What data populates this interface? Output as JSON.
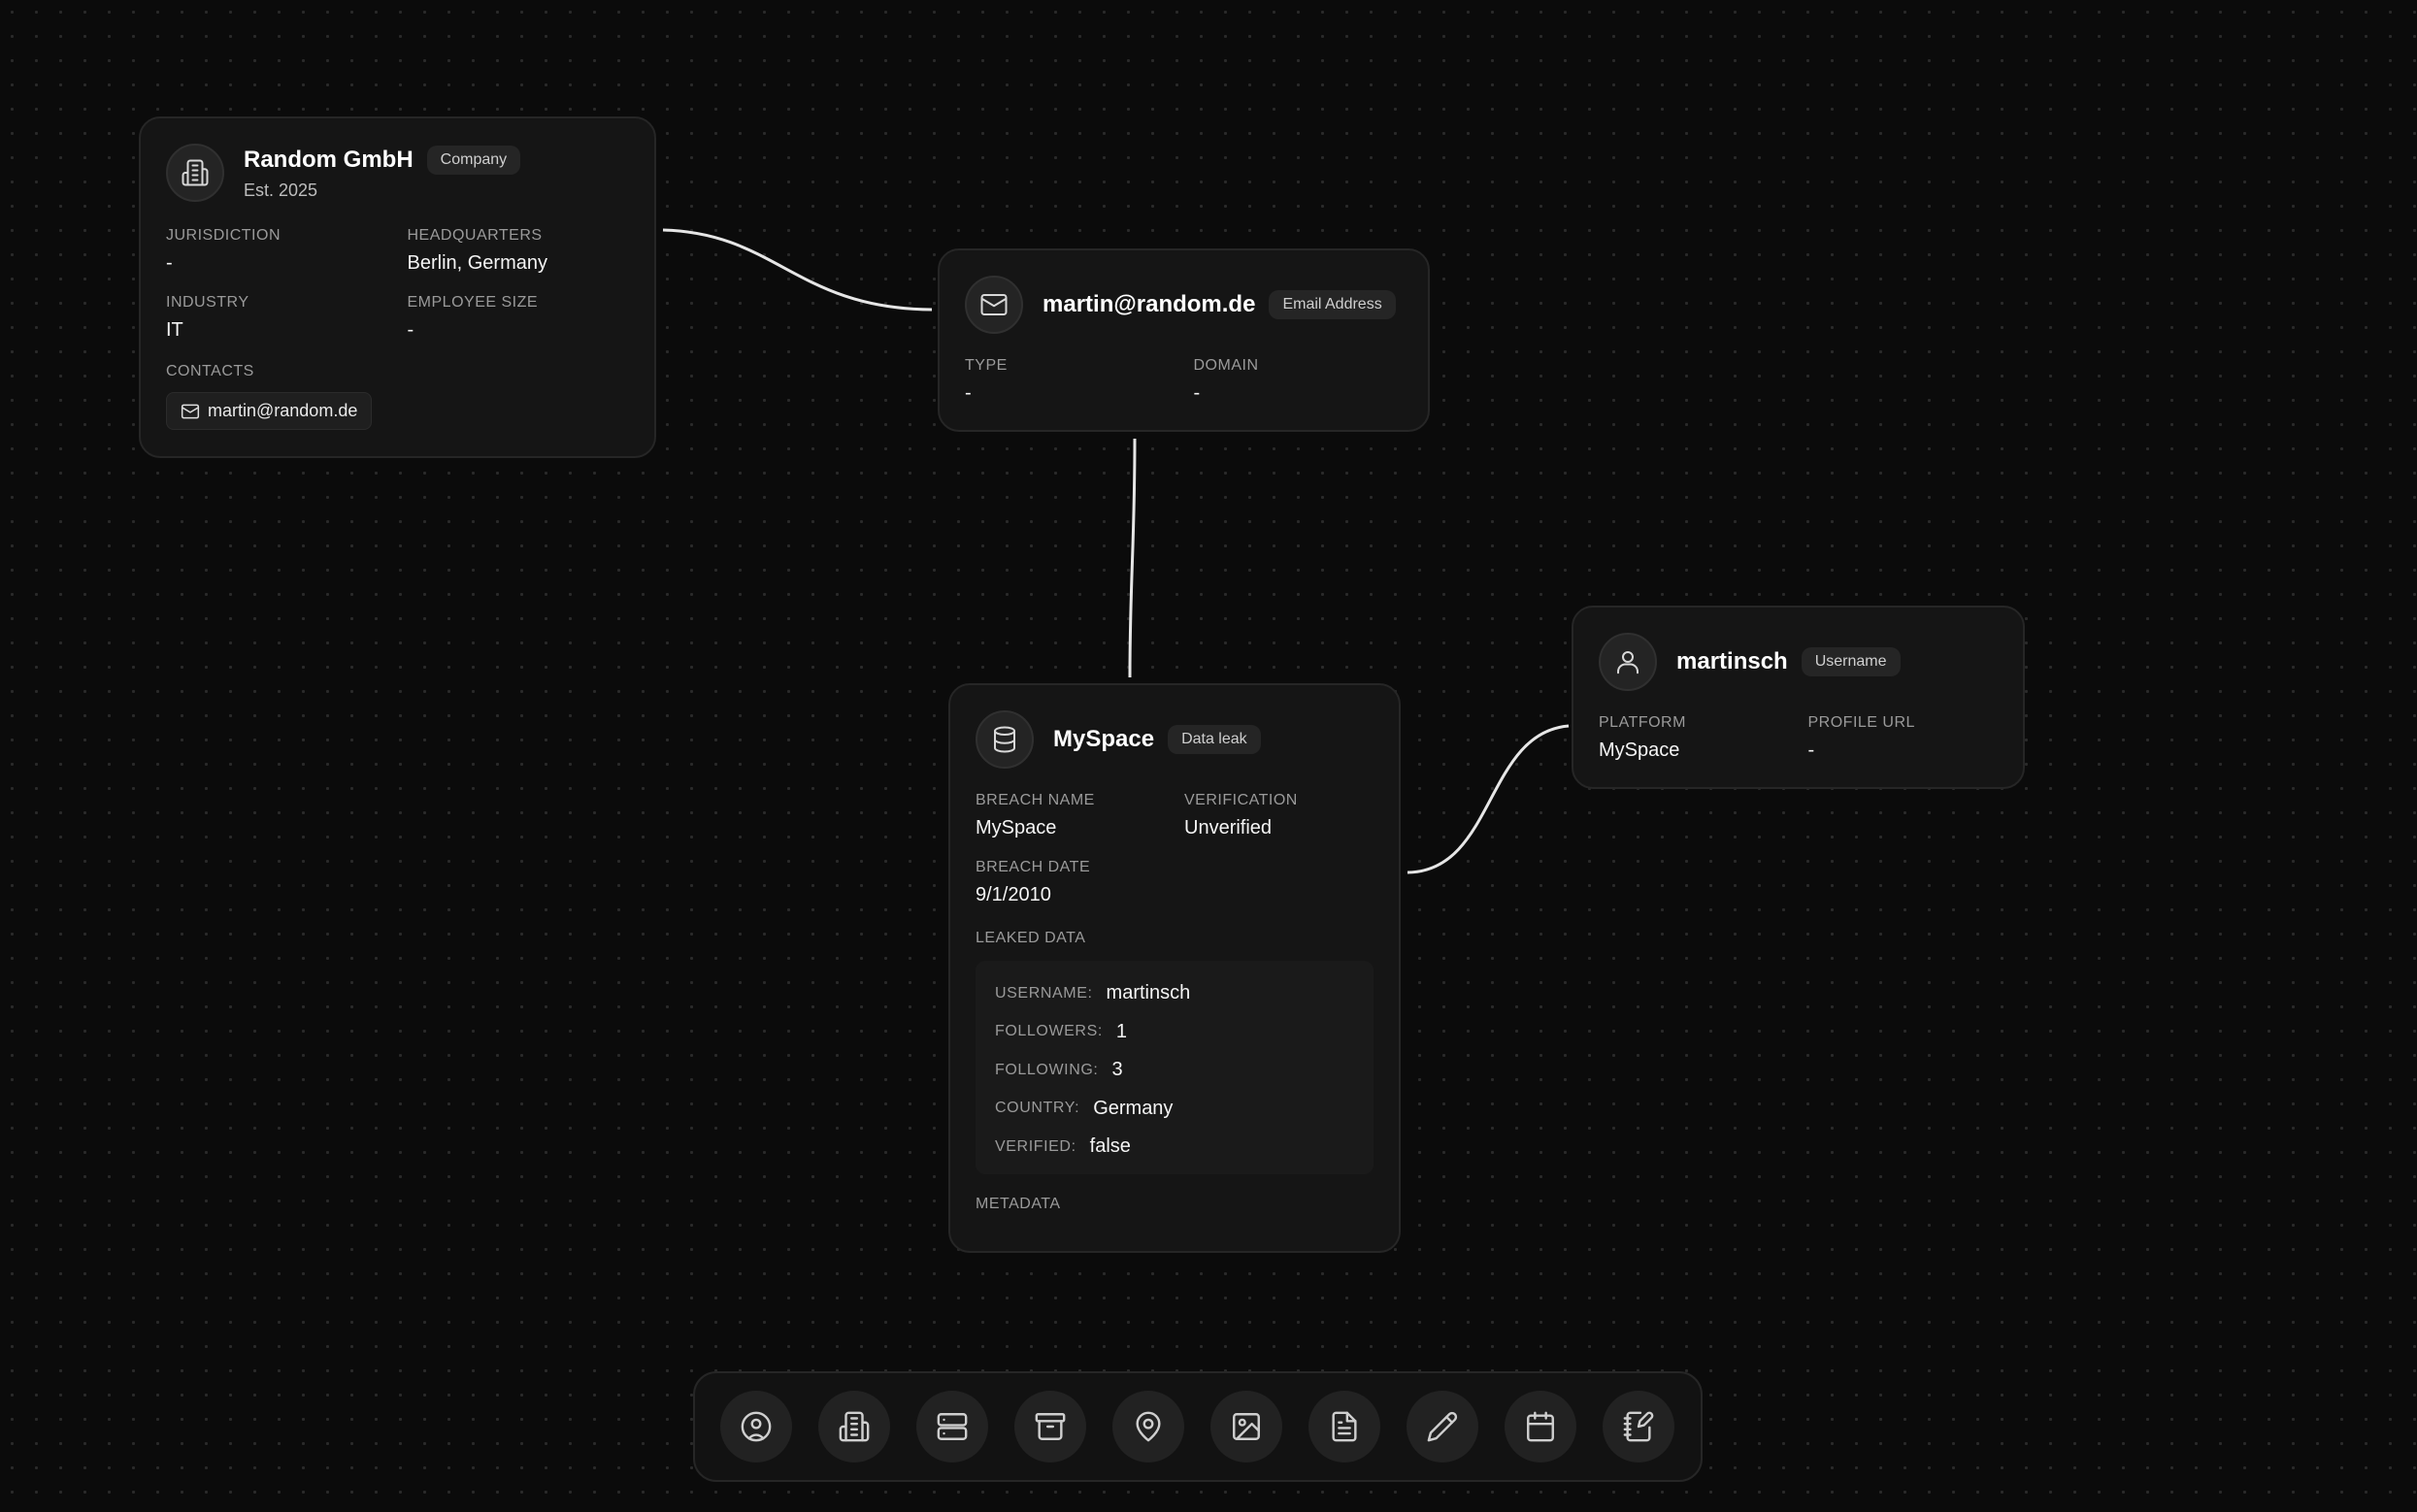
{
  "nodes": {
    "company": {
      "title": "Random GmbH",
      "badge": "Company",
      "subtitle": "Est. 2025",
      "icon": "building-icon",
      "fields": [
        {
          "label": "JURISDICTION",
          "value": "-"
        },
        {
          "label": "HEADQUARTERS",
          "value": "Berlin, Germany"
        },
        {
          "label": "INDUSTRY",
          "value": "IT"
        },
        {
          "label": "EMPLOYEE SIZE",
          "value": "-"
        }
      ],
      "contacts_label": "CONTACTS",
      "contacts": [
        {
          "icon": "mail-icon",
          "text": "martin@random.de"
        }
      ]
    },
    "email": {
      "title": "martin@random.de",
      "badge": "Email Address",
      "icon": "mail-icon",
      "fields": [
        {
          "label": "TYPE",
          "value": "-"
        },
        {
          "label": "DOMAIN",
          "value": "-"
        }
      ]
    },
    "breach": {
      "title": "MySpace",
      "badge": "Data leak",
      "icon": "database-icon",
      "fields": [
        {
          "label": "BREACH NAME",
          "value": "MySpace"
        },
        {
          "label": "VERIFICATION",
          "value": "Unverified"
        },
        {
          "label": "BREACH DATE",
          "value": "9/1/2010"
        }
      ],
      "leaked_label": "LEAKED DATA",
      "leaked": [
        {
          "key": "USERNAME:",
          "value": "martinsch"
        },
        {
          "key": "FOLLOWERS:",
          "value": "1"
        },
        {
          "key": "FOLLOWING:",
          "value": "3"
        },
        {
          "key": "COUNTRY:",
          "value": "Germany"
        },
        {
          "key": "VERIFIED:",
          "value": "false"
        }
      ],
      "metadata_label": "METADATA"
    },
    "username": {
      "title": "martinsch",
      "badge": "Username",
      "icon": "user-icon",
      "fields": [
        {
          "label": "PLATFORM",
          "value": "MySpace"
        },
        {
          "label": "PROFILE URL",
          "value": "-"
        }
      ]
    }
  },
  "toolbar": [
    {
      "icon": "user-circle-icon"
    },
    {
      "icon": "building-icon"
    },
    {
      "icon": "server-icon"
    },
    {
      "icon": "archive-icon"
    },
    {
      "icon": "map-pin-icon"
    },
    {
      "icon": "image-icon"
    },
    {
      "icon": "file-text-icon"
    },
    {
      "icon": "pencil-icon"
    },
    {
      "icon": "calendar-icon"
    },
    {
      "icon": "notebook-pen-icon"
    }
  ],
  "colors": {
    "background": "#0b0b0b",
    "card": "#151515",
    "edge": "#e6e6e6"
  }
}
